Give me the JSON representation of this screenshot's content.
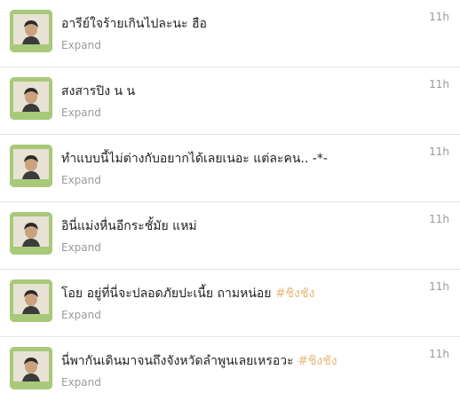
{
  "tweets": [
    {
      "text": "อารีย์ใจร้ายเกินไปละนะ ฮือ",
      "hashtag": "",
      "expand": "Expand",
      "time": "11h"
    },
    {
      "text": "สงสารปิง น น",
      "hashtag": "",
      "expand": "Expand",
      "time": "11h"
    },
    {
      "text": "ทำแบบนี้ไม่ต่างกับอยากได้เลยเนอะ แต่ละคน.. -*-",
      "hashtag": "",
      "expand": "Expand",
      "time": "11h"
    },
    {
      "text": "อินี่แม่งหื่นอีกระชั้มัย แหม่",
      "hashtag": "",
      "expand": "Expand",
      "time": "11h"
    },
    {
      "text": "โอย อยู่ที่นี่จะปลอดภัยปะเนี้ย ถามหน่อย ",
      "hashtag": "#ชิงชัง",
      "expand": "Expand",
      "time": "11h"
    },
    {
      "text": "นี่พากันเดินมาจนถึงจังหวัดลำพูนเลยเหรอวะ ",
      "hashtag": "#ชิงชัง",
      "expand": "Expand",
      "time": "11h"
    }
  ],
  "colors": {
    "hashtag": "#e8b87a",
    "meta_text": "#9a9a9a",
    "tweet_text": "#222222",
    "avatar_bg": "#a9c97a"
  }
}
